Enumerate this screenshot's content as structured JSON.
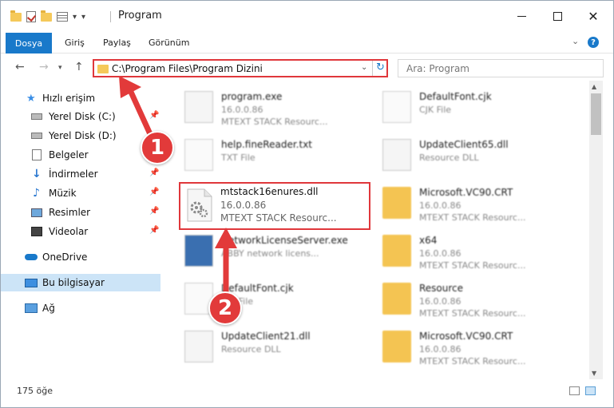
{
  "window": {
    "title": "Program"
  },
  "ribbon": {
    "file_tab": "Dosya",
    "tabs": [
      "Giriş",
      "Paylaş",
      "Görünüm"
    ],
    "help": "?"
  },
  "nav": {
    "address": "C:\\Program Files\\Program Dizini",
    "search_placeholder": "Ara: Program"
  },
  "sidebar": {
    "items": [
      {
        "label": "Hızlı erişim",
        "icon": "star-icon"
      },
      {
        "label": "Yerel Disk (C:)",
        "icon": "drive-icon"
      },
      {
        "label": "Yerel Disk (D:)",
        "icon": "drive-icon"
      },
      {
        "label": "Belgeler",
        "icon": "documents-icon"
      },
      {
        "label": "İndirmeler",
        "icon": "download-icon"
      },
      {
        "label": "Müzik",
        "icon": "music-icon"
      },
      {
        "label": "Resimler",
        "icon": "pictures-icon"
      },
      {
        "label": "Videolar",
        "icon": "video-icon"
      },
      {
        "label": "OneDrive",
        "icon": "cloud-icon"
      },
      {
        "label": "Bu bilgisayar",
        "icon": "computer-icon"
      },
      {
        "label": "Ağ",
        "icon": "network-icon"
      }
    ]
  },
  "files": [
    {
      "name": "program.exe",
      "line2": "16.0.0.86",
      "line3": "MTEXT STACK Resourc..."
    },
    {
      "name": "DefaultFont.cjk",
      "line2": "CJK File",
      "line3": ""
    },
    {
      "name": "help.fineReader.txt",
      "line2": "TXT File",
      "line3": ""
    },
    {
      "name": "UpdateClient65.dll",
      "line2": "Resource DLL",
      "line3": ""
    },
    {
      "name": "mtstack16enures.dll",
      "line2": "16.0.0.86",
      "line3": "MTEXT STACK Resourc..."
    },
    {
      "name": "Microsoft.VC90.CRT",
      "line2": "16.0.0.86",
      "line3": "MTEXT STACK Resourc..."
    },
    {
      "name": "NetworkLicenseServer.exe",
      "line2": "ABBY network licens...",
      "line3": ""
    },
    {
      "name": "x64",
      "line2": "16.0.0.86",
      "line3": "MTEXT STACK Resourc..."
    },
    {
      "name": "DefaultFont.cjk",
      "line2": "CJK File",
      "line3": ""
    },
    {
      "name": "Resource",
      "line2": "16.0.0.86",
      "line3": "MTEXT STACK Resourc..."
    },
    {
      "name": "UpdateClient21.dll",
      "line2": "Resource DLL",
      "line3": ""
    },
    {
      "name": "Microsoft.VC90.CRT",
      "line2": "16.0.0.86",
      "line3": "MTEXT STACK Resourc..."
    }
  ],
  "status": {
    "count": "175 öğe"
  },
  "annotations": {
    "step1": "1",
    "step2": "2"
  },
  "colors": {
    "accent": "#1979ca",
    "highlight": "#e0373b",
    "selection": "#cce4f7"
  }
}
